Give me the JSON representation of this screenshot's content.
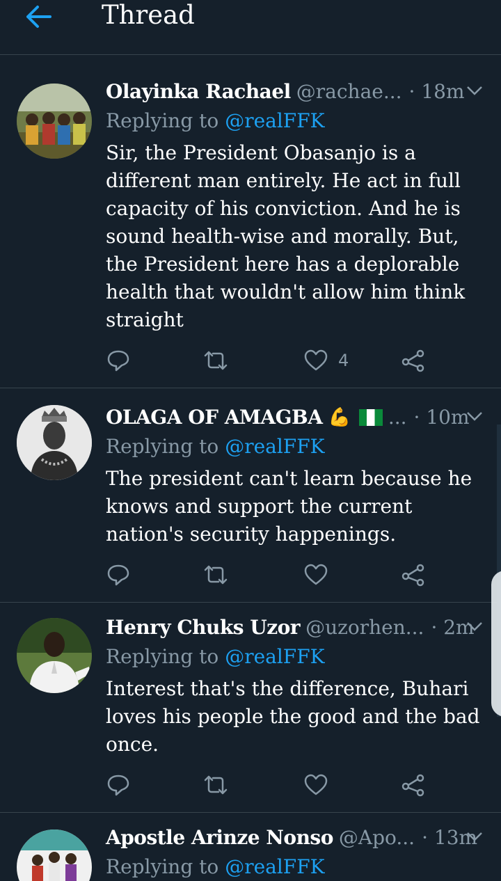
{
  "header": {
    "title": "Thread"
  },
  "colors": {
    "background": "#15202b",
    "accent": "#1da1f2",
    "muted": "#8899a6",
    "divider": "#38444d"
  },
  "tweets": [
    {
      "name": "Olayinka Rachael",
      "handle": "@rachae...",
      "time": "· 18m",
      "replying_prefix": "Replying to",
      "mention": "@realFFK",
      "text": "Sir, the President Obasanjo is a different man entirely. He act in full capacity of his conviction. And he is sound health-wise and morally. But, the President here has a deplorable health that wouldn't allow him think straight",
      "likes": "4"
    },
    {
      "name": "OLAGA OF AMAGBA",
      "name_emoji": "💪",
      "handle": "...",
      "time": "· 10m",
      "replying_prefix": "Replying to",
      "mention": "@realFFK",
      "text": "The president can't learn because he knows and support the current nation's security happenings."
    },
    {
      "name": "Henry Chuks Uzor",
      "handle": "@uzorhen...",
      "time": "· 2m",
      "replying_prefix": "Replying to",
      "mention": "@realFFK",
      "text": "Interest that's the difference, Buhari loves his people the good and the bad once."
    },
    {
      "name": "Apostle Arinze Nonso",
      "handle": "@Apo...",
      "time": "· 13m",
      "replying_prefix": "Replying to",
      "mention": "@realFFK"
    }
  ]
}
